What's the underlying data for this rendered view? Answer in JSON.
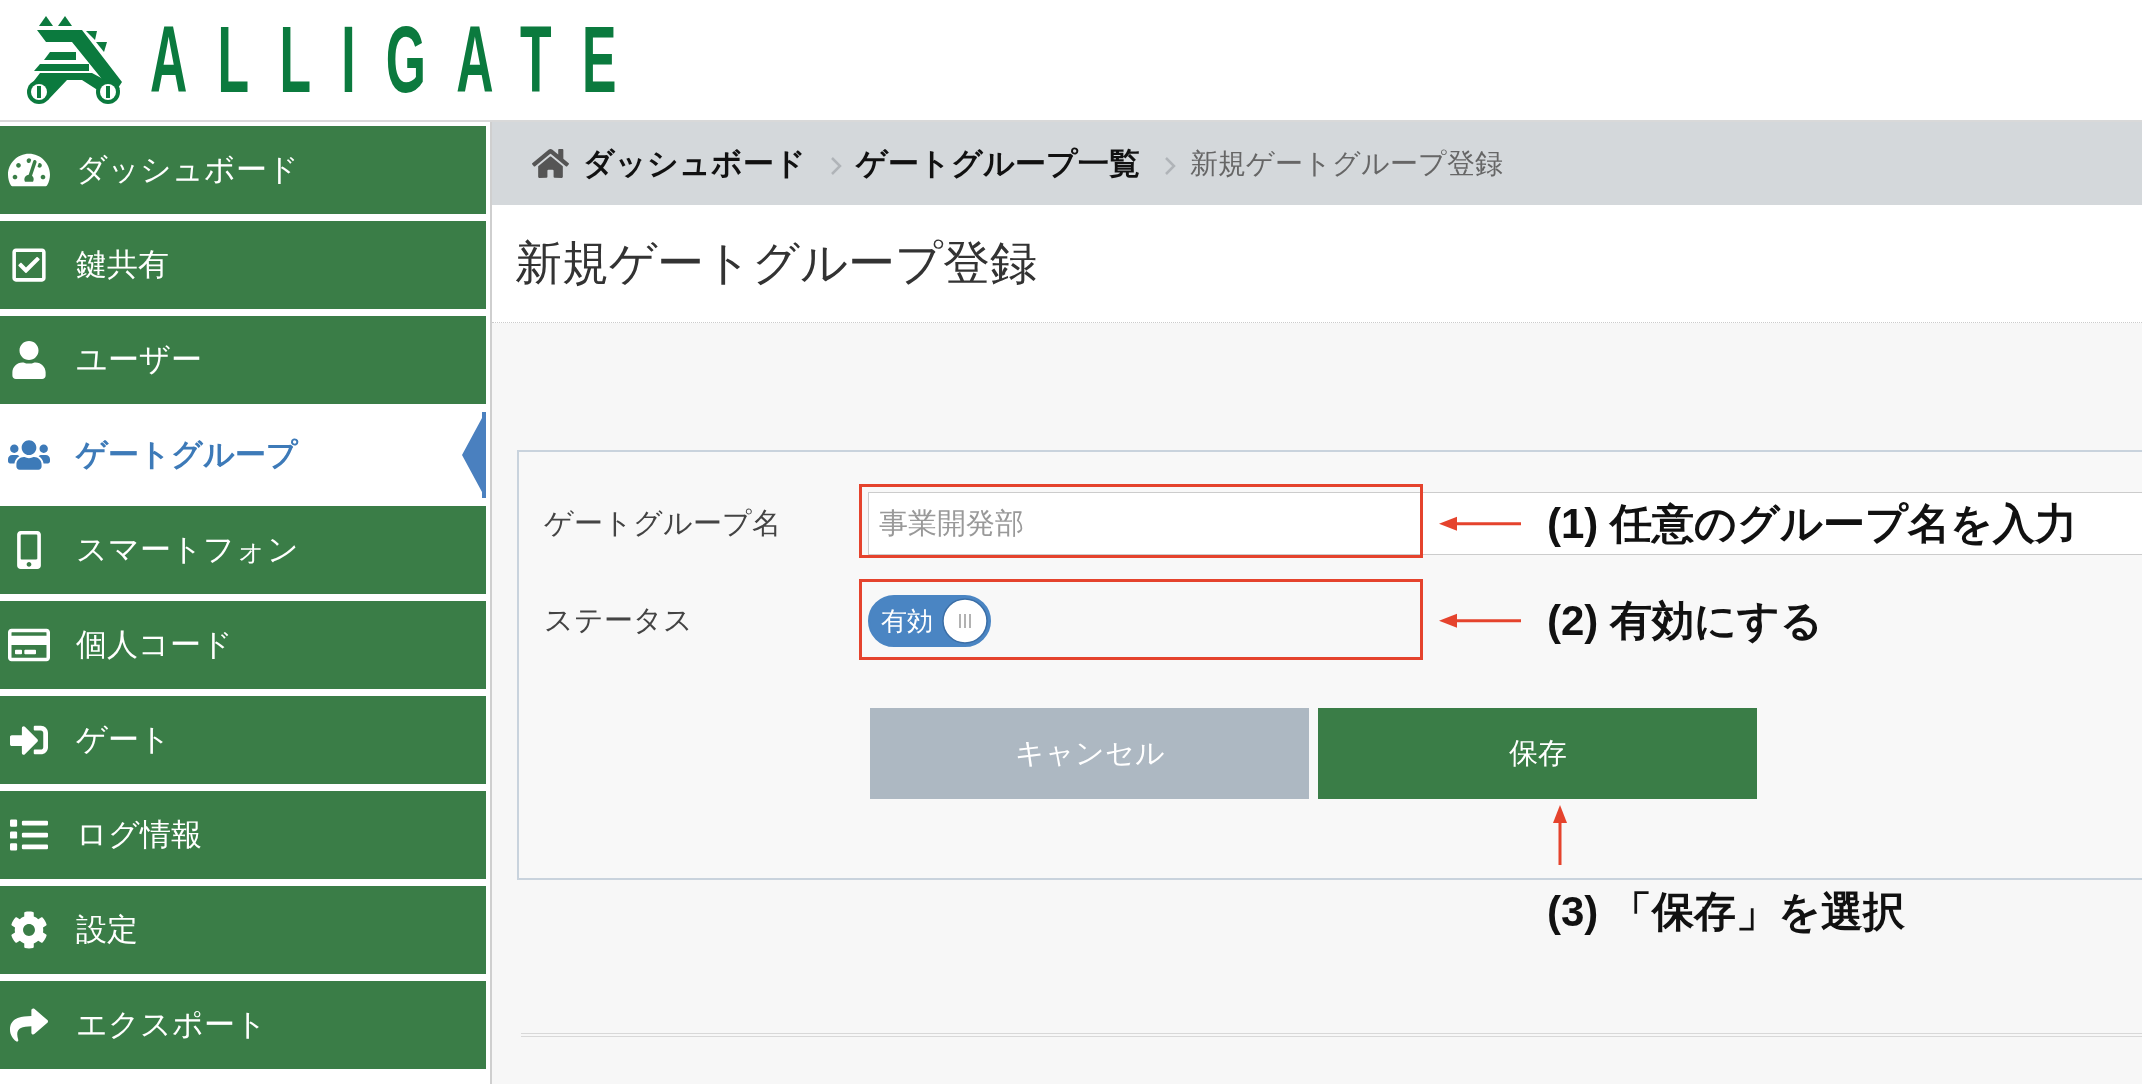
{
  "logo": {
    "text": "ALLIGATE"
  },
  "sidebar": {
    "items": [
      {
        "label": "ダッシュボード",
        "selected": false
      },
      {
        "label": "鍵共有",
        "selected": false
      },
      {
        "label": "ユーザー",
        "selected": false
      },
      {
        "label": "ゲートグループ",
        "selected": true
      },
      {
        "label": "スマートフォン",
        "selected": false
      },
      {
        "label": "個人コード",
        "selected": false
      },
      {
        "label": "ゲート",
        "selected": false
      },
      {
        "label": "ログ情報",
        "selected": false
      },
      {
        "label": "設定",
        "selected": false
      },
      {
        "label": "エクスポート",
        "selected": false
      }
    ]
  },
  "breadcrumb": [
    {
      "label": "ダッシュボード",
      "current": false
    },
    {
      "label": "ゲートグループ一覧",
      "current": false
    },
    {
      "label": "新規ゲートグループ登録",
      "current": true
    }
  ],
  "page_title": "新規ゲートグループ登録",
  "form": {
    "fields": [
      {
        "kind": "text",
        "label": "ゲートグループ名",
        "placeholder": "事業開発部",
        "highlighted": true,
        "annotation": "(1) 任意のグループ名を入力"
      },
      {
        "kind": "toggle",
        "label": "ステータス",
        "on": true,
        "on_label": "有効",
        "highlighted": true,
        "annotation": "(2) 有効にする"
      }
    ],
    "buttons": [
      {
        "kind": "cancel",
        "label": "キャンセル"
      },
      {
        "kind": "save",
        "label": "保存",
        "annotation": "(3) 「保存」を選択"
      }
    ]
  }
}
